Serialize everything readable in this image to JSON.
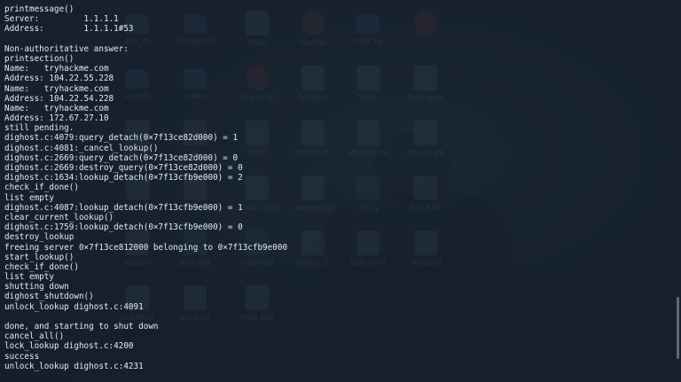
{
  "desktop": {
    "icons": [
      {
        "label": "file_m",
        "kind": "folder"
      },
      {
        "label": "ThreatInt",
        "kind": "folder"
      },
      {
        "label": "Tools",
        "kind": "file"
      },
      {
        "label": "Firefox",
        "kind": "orange"
      },
      {
        "label": "New Fil",
        "kind": "folder"
      },
      {
        "label": "...",
        "kind": "red"
      },
      {
        "label": "scripts",
        "kind": "folder"
      },
      {
        "label": "tools",
        "kind": "folder"
      },
      {
        "label": "Brave W",
        "kind": "red"
      },
      {
        "label": "hidibbr",
        "kind": "file"
      },
      {
        "label": "burp",
        "kind": "file"
      },
      {
        "label": "Test sear",
        "kind": "file"
      },
      {
        "label": "exploit",
        "kind": "file"
      },
      {
        "label": "lab",
        "kind": "file"
      },
      {
        "label": "html",
        "kind": "file"
      },
      {
        "label": "test.html",
        "kind": "file"
      },
      {
        "label": "shell.html",
        "kind": "file"
      },
      {
        "label": "image.gif",
        "kind": "file"
      },
      {
        "label": "payload",
        "kind": "file"
      },
      {
        "label": "sf.html",
        "kind": "file"
      },
      {
        "label": "shell.java",
        "kind": "file"
      },
      {
        "label": "poomp.py",
        "kind": "file"
      },
      {
        "label": "tot.py",
        "kind": "green"
      },
      {
        "label": "A-Z Kali",
        "kind": "file"
      },
      {
        "label": "xss.py",
        "kind": "file"
      },
      {
        "label": "pswd24",
        "kind": "green"
      },
      {
        "label": "Practical",
        "kind": "green"
      },
      {
        "label": "video_2",
        "kind": "file"
      },
      {
        "label": "bbp.html",
        "kind": "file"
      },
      {
        "label": "Metaspl",
        "kind": "file"
      },
      {
        "label": "xss.html",
        "kind": "file"
      },
      {
        "label": "shell.sh",
        "kind": "file"
      },
      {
        "label": "Web Bro",
        "kind": "file"
      }
    ]
  },
  "terminal": {
    "lines": [
      "printmessage()",
      "Server:         1.1.1.1",
      "Address:        1.1.1.1#53",
      "",
      "Non-authoritative answer:",
      "printsection()",
      "Name:   tryhackme.com",
      "Address: 104.22.55.228",
      "Name:   tryhackme.com",
      "Address: 104.22.54.228",
      "Name:   tryhackme.com",
      "Address: 172.67.27.10",
      "still pending.",
      "dighost.c:4079:query_detach(0×7f13ce82d000) = 1",
      "dighost.c:4081:_cancel_lookup()",
      "dighost.c:2669:query_detach(0×7f13ce82d000) = 0",
      "dighost.c:2669:destroy_query(0×7f13ce82d000) = 0",
      "dighost.c:1634:lookup_detach(0×7f13cfb9e000) = 2",
      "check_if_done()",
      "list empty",
      "dighost.c:4087:lookup_detach(0×7f13cfb9e000) = 1",
      "clear_current_lookup()",
      "dighost.c:1759:lookup_detach(0×7f13cfb9e000) = 0",
      "destroy_lookup",
      "freeing server 0×7f13ce812000 belonging to 0×7f13cfb9e000",
      "start_lookup()",
      "check_if_done()",
      "list empty",
      "shutting down",
      "dighost_shutdown()",
      "unlock_lookup dighost.c:4091",
      "",
      "done, and starting to shut down",
      "cancel_all()",
      "lock_lookup dighost.c:4200",
      "success",
      "unlock_lookup dighost.c:4231"
    ]
  }
}
